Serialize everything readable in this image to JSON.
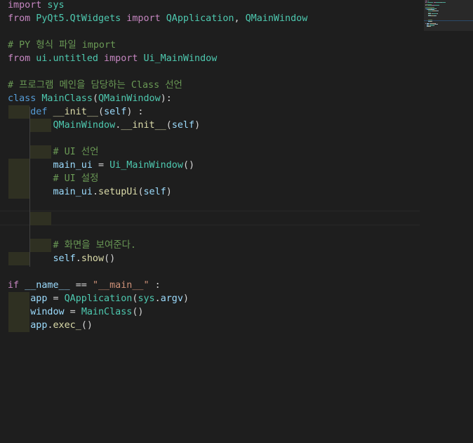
{
  "editor": {
    "lines": [
      [
        {
          "t": "import",
          "c": "kw2"
        },
        {
          "t": " sys",
          "c": "cls"
        }
      ],
      [
        {
          "t": "from",
          "c": "kw2"
        },
        {
          "t": " PyQt5.QtWidgets",
          "c": "cls"
        },
        {
          "t": " import",
          "c": "kw2"
        },
        {
          "t": " QApplication",
          "c": "cls"
        },
        {
          "t": ", ",
          "c": "pl"
        },
        {
          "t": "QMainWindow",
          "c": "cls"
        }
      ],
      [],
      [
        {
          "t": "# PY 형식 파일 import",
          "c": "cmt"
        }
      ],
      [
        {
          "t": "from",
          "c": "kw2"
        },
        {
          "t": " ui.untitled",
          "c": "cls"
        },
        {
          "t": " import",
          "c": "kw2"
        },
        {
          "t": " Ui_MainWindow",
          "c": "cls"
        }
      ],
      [],
      [
        {
          "t": "# 프로그램 메인을 담당하는 Class 선언",
          "c": "cmt"
        }
      ],
      [
        {
          "t": "class",
          "c": "kw"
        },
        {
          "t": " MainClass",
          "c": "cls"
        },
        {
          "t": "(",
          "c": "pl"
        },
        {
          "t": "QMainWindow",
          "c": "cls"
        },
        {
          "t": "):",
          "c": "pl"
        }
      ],
      [
        {
          "t": "    ",
          "c": "pl"
        },
        {
          "t": "def",
          "c": "kw"
        },
        {
          "t": " __init__",
          "c": "fn"
        },
        {
          "t": "(",
          "c": "pl"
        },
        {
          "t": "self",
          "c": "var"
        },
        {
          "t": ") :",
          "c": "pl"
        }
      ],
      [
        {
          "t": "        ",
          "c": "pl"
        },
        {
          "t": "QMainWindow",
          "c": "cls"
        },
        {
          "t": ".",
          "c": "pl"
        },
        {
          "t": "__init__",
          "c": "fn"
        },
        {
          "t": "(",
          "c": "pl"
        },
        {
          "t": "self",
          "c": "var"
        },
        {
          "t": ")",
          "c": "pl"
        }
      ],
      [],
      [
        {
          "t": "        ",
          "c": "pl"
        },
        {
          "t": "# UI 선언",
          "c": "cmt"
        }
      ],
      [
        {
          "t": "        ",
          "c": "pl"
        },
        {
          "t": "main_ui",
          "c": "var"
        },
        {
          "t": " = ",
          "c": "pl"
        },
        {
          "t": "Ui_MainWindow",
          "c": "cls"
        },
        {
          "t": "()",
          "c": "pl"
        }
      ],
      [
        {
          "t": "        ",
          "c": "pl"
        },
        {
          "t": "# UI 설정",
          "c": "cmt"
        }
      ],
      [
        {
          "t": "        ",
          "c": "pl"
        },
        {
          "t": "main_ui",
          "c": "var"
        },
        {
          "t": ".",
          "c": "pl"
        },
        {
          "t": "setupUi",
          "c": "fn"
        },
        {
          "t": "(",
          "c": "pl"
        },
        {
          "t": "self",
          "c": "var"
        },
        {
          "t": ")",
          "c": "pl"
        }
      ],
      [],
      [],
      [],
      [
        {
          "t": "        ",
          "c": "pl"
        },
        {
          "t": "# 화면을 보여준다.",
          "c": "cmt"
        }
      ],
      [
        {
          "t": "        ",
          "c": "pl"
        },
        {
          "t": "self",
          "c": "var"
        },
        {
          "t": ".",
          "c": "pl"
        },
        {
          "t": "show",
          "c": "fn"
        },
        {
          "t": "()",
          "c": "pl"
        }
      ],
      [],
      [
        {
          "t": "if",
          "c": "kw2"
        },
        {
          "t": " __name__",
          "c": "var"
        },
        {
          "t": " == ",
          "c": "pl"
        },
        {
          "t": "\"__main__\"",
          "c": "str"
        },
        {
          "t": " :",
          "c": "pl"
        }
      ],
      [
        {
          "t": "    ",
          "c": "pl"
        },
        {
          "t": "app",
          "c": "var"
        },
        {
          "t": " = ",
          "c": "pl"
        },
        {
          "t": "QApplication",
          "c": "cls"
        },
        {
          "t": "(",
          "c": "pl"
        },
        {
          "t": "sys",
          "c": "cls"
        },
        {
          "t": ".",
          "c": "pl"
        },
        {
          "t": "argv",
          "c": "var"
        },
        {
          "t": ")",
          "c": "pl"
        }
      ],
      [
        {
          "t": "    ",
          "c": "pl"
        },
        {
          "t": "window",
          "c": "var"
        },
        {
          "t": " = ",
          "c": "pl"
        },
        {
          "t": "MainClass",
          "c": "cls"
        },
        {
          "t": "()",
          "c": "pl"
        }
      ],
      [
        {
          "t": "    ",
          "c": "pl"
        },
        {
          "t": "app",
          "c": "var"
        },
        {
          "t": ".",
          "c": "pl"
        },
        {
          "t": "exec_",
          "c": "fn"
        },
        {
          "t": "()",
          "c": "pl"
        }
      ]
    ],
    "guides": [
      {
        "line": 8,
        "g": 1
      },
      {
        "line": 9,
        "g": 2
      },
      {
        "line": 11,
        "g": 2
      },
      {
        "line": 12,
        "g": 1
      },
      {
        "line": 13,
        "g": 1
      },
      {
        "line": 14,
        "g": 1
      },
      {
        "line": 16,
        "g": 2
      },
      {
        "line": 18,
        "g": 2
      },
      {
        "line": 19,
        "g": 1
      },
      {
        "line": 22,
        "g": 1
      },
      {
        "line": 23,
        "g": 1
      },
      {
        "line": 24,
        "g": 1
      }
    ],
    "colors": {
      "background": "#1e1e1e",
      "keyword": "#569cd6",
      "control": "#c586c0",
      "function": "#dcdcaa",
      "class": "#4ec9b0",
      "variable": "#9cdcfe",
      "string": "#ce9178",
      "comment": "#6a9955",
      "text": "#d4d4d4"
    }
  }
}
